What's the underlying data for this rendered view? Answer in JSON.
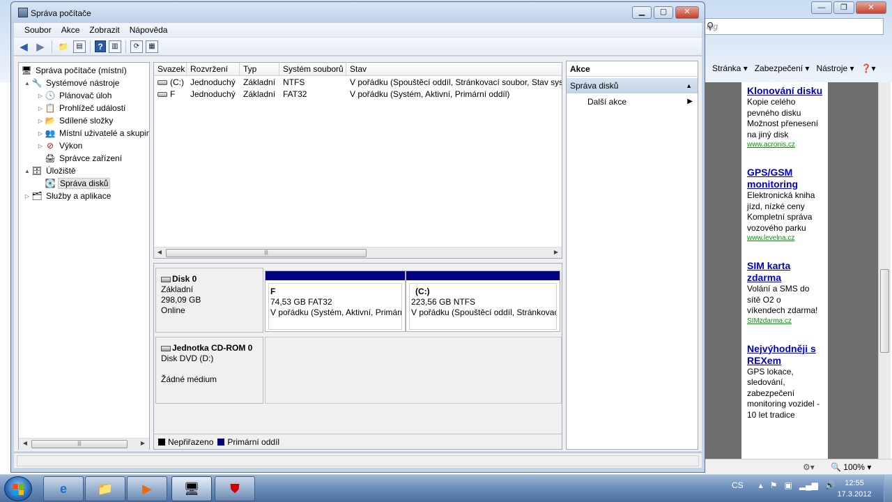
{
  "window": {
    "title": "Správa počítače",
    "menu": [
      "Soubor",
      "Akce",
      "Zobrazit",
      "Nápověda"
    ]
  },
  "tree": {
    "items": [
      {
        "label": "Správa počítače (místní)",
        "level": 0,
        "expander": "",
        "icon": "computer-management-icon"
      },
      {
        "label": "Systémové nástroje",
        "level": 1,
        "expander": "▲",
        "icon": "tools-icon"
      },
      {
        "label": "Plánovač úloh",
        "level": 2,
        "expander": "▷",
        "icon": "clock-icon"
      },
      {
        "label": "Prohlížeč událostí",
        "level": 2,
        "expander": "▷",
        "icon": "event-viewer-icon"
      },
      {
        "label": "Sdílené složky",
        "level": 2,
        "expander": "▷",
        "icon": "shared-folder-icon"
      },
      {
        "label": "Místní uživatelé a skupiny",
        "level": 2,
        "expander": "▷",
        "icon": "users-icon"
      },
      {
        "label": "Výkon",
        "level": 2,
        "expander": "▷",
        "icon": "performance-icon"
      },
      {
        "label": "Správce zařízení",
        "level": 2,
        "expander": "",
        "icon": "device-manager-icon"
      },
      {
        "label": "Úložiště",
        "level": 1,
        "expander": "▲",
        "icon": "storage-icon"
      },
      {
        "label": "Správa disků",
        "level": 2,
        "expander": "",
        "icon": "disk-management-icon",
        "selected": true
      },
      {
        "label": "Služby a aplikace",
        "level": 1,
        "expander": "▷",
        "icon": "services-icon"
      }
    ]
  },
  "volumes": {
    "columns": [
      "Svazek",
      "Rozvržení",
      "Typ",
      "Systém souborů",
      "Stav"
    ],
    "rows": [
      [
        "(C:)",
        "Jednoduchý",
        "Základní",
        "NTFS",
        "V pořádku (Spouštěcí oddíl, Stránkovací soubor, Stav systému, Primární oddíl)"
      ],
      [
        "F",
        "Jednoduchý",
        "Základní",
        "FAT32",
        "V pořádku (Systém, Aktivní, Primární oddíl)"
      ]
    ]
  },
  "disks": [
    {
      "name": "Disk 0",
      "type": "Základní",
      "size": "298,09 GB",
      "state": "Online",
      "partitions": [
        {
          "label": "F",
          "size": "74,53 GB FAT32",
          "status": "V pořádku (Systém, Aktivní, Primární oddíl)"
        },
        {
          "label": "(C:)",
          "size": "223,56 GB NTFS",
          "status": "V pořádku (Spouštěcí oddíl, Stránkovací soubor)"
        }
      ]
    },
    {
      "name": "Jednotka CD-ROM 0",
      "type": "Disk DVD (D:)",
      "state": "Žádné médium"
    }
  ],
  "legend": [
    {
      "label": "Nepřiřazeno",
      "color": "#000000"
    },
    {
      "label": "Primární oddíl",
      "color": "#000080"
    }
  ],
  "actions": {
    "header": "Akce",
    "section": "Správa disků",
    "more": "Další akce"
  },
  "browser": {
    "address_placeholder": "ing",
    "commands": [
      "Stránka ▾",
      "Zabezpečení ▾",
      "Nástroje ▾",
      "❓▾"
    ],
    "zoom": "100%",
    "ads": [
      {
        "title": "Klonování disku",
        "lines": [
          "Kopie celého",
          "pevného disku",
          "Možnost přenesení",
          "na jiný disk"
        ],
        "link": "www.acronis.cz"
      },
      {
        "title": "GPS/GSM monitoring",
        "lines": [
          "Elektronická kniha",
          "jízd, nízké ceny",
          "Kompletní správa",
          "vozového parku"
        ],
        "link": "www.levelna.cz"
      },
      {
        "title": "SIM karta zdarma",
        "lines": [
          "Volání a SMS do",
          "sítě O2 o",
          "víkendech zdarma!"
        ],
        "link": "SIMzdarma.cz"
      },
      {
        "title": "Nejvýhodněji s REXem",
        "lines": [
          "GPS lokace,",
          "sledování,",
          "zabezpečení",
          "monitoring vozidel -",
          "10 let tradice"
        ],
        "link": ""
      }
    ]
  },
  "taskbar": {
    "lang": "CS",
    "time": "12:55",
    "date": "17.3.2012"
  }
}
